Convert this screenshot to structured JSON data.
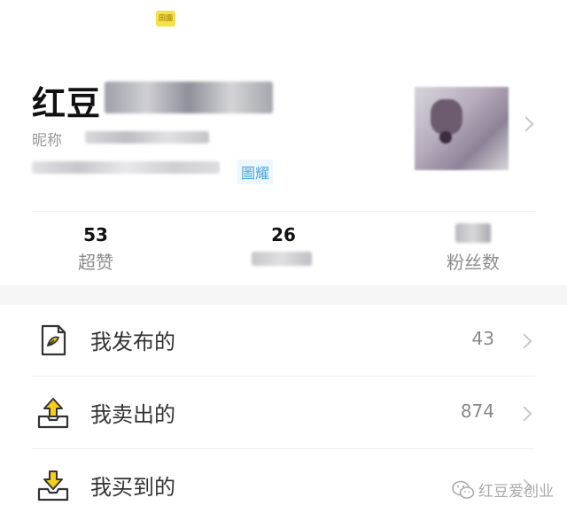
{
  "header": {
    "badge": "田園"
  },
  "profile": {
    "name": "红豆",
    "nickname_label": "昵称",
    "fans_tag": "圖耀"
  },
  "stats": [
    {
      "value": "53",
      "label": "超赞"
    },
    {
      "value": "26",
      "label": ""
    },
    {
      "value": "",
      "label": "粉丝数"
    }
  ],
  "menu": [
    {
      "label": "我发布的",
      "count": "43",
      "icon": "document-icon"
    },
    {
      "label": "我卖出的",
      "count": "874",
      "icon": "upload-box-icon"
    },
    {
      "label": "我买到的",
      "count": "",
      "icon": "download-box-icon"
    }
  ],
  "watermark": {
    "text": "红豆爱创业",
    "icon": "wechat-icon"
  },
  "colors": {
    "accent_yellow": "#f7e04a",
    "link_blue": "#4aa6d8",
    "icon_yellow": "#f5cf1e"
  }
}
